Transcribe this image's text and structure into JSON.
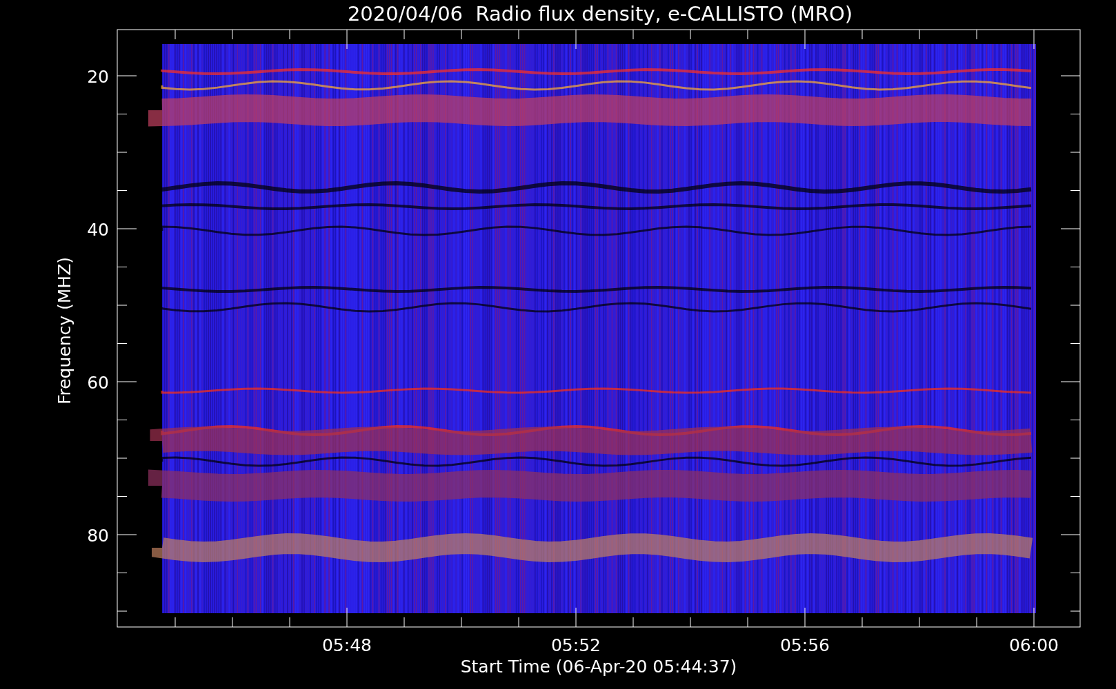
{
  "title": "2020/04/06  Radio flux density, e-CALLISTO (MRO)",
  "y_axis": {
    "label": "Frequency (MHZ)",
    "ticks": [
      "20",
      "40",
      "60",
      "80"
    ]
  },
  "x_axis": {
    "label": "Start Time (06-Apr-20 05:44:37)",
    "ticks": [
      "05:48",
      "05:52",
      "05:56",
      "06:00"
    ]
  }
}
